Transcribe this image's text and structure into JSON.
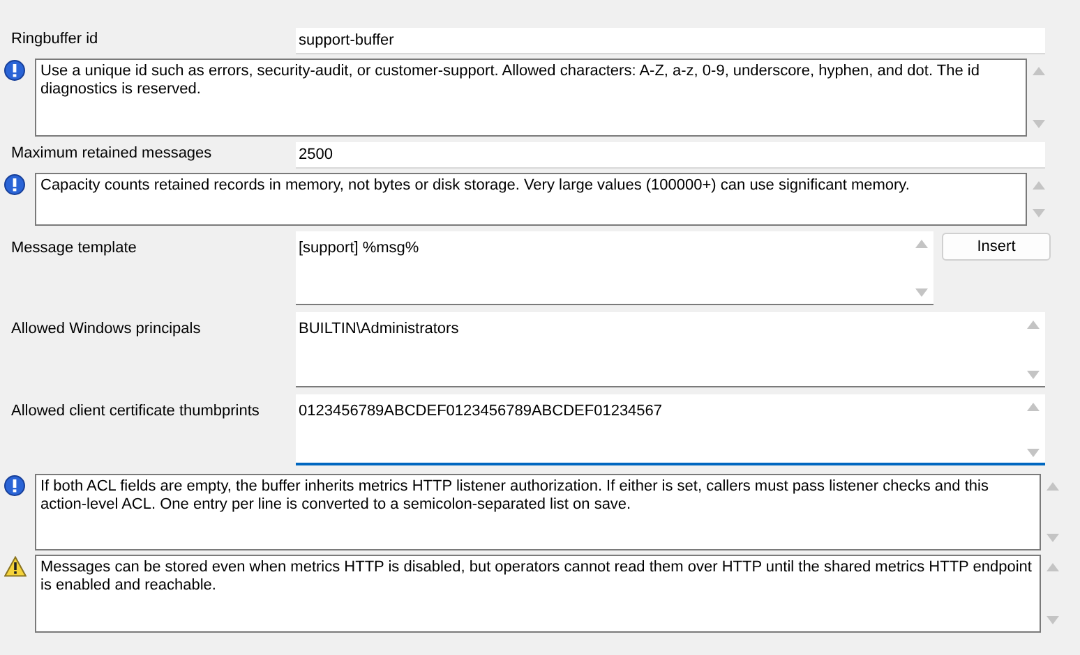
{
  "items": [
    {
      "kind": "text",
      "label": "Ringbuffer id",
      "value": "support-buffer"
    },
    {
      "kind": "info",
      "text": "Use a unique id such as errors, security-audit, or customer-support. Allowed characters: A-Z, a-z, 0-9, underscore, hyphen, and dot. The id diagnostics is reserved."
    },
    {
      "kind": "text",
      "label": "Maximum retained messages",
      "value": "2500"
    },
    {
      "kind": "info",
      "text": "Capacity counts retained records in memory, not bytes or disk storage. Very large values (100000+) can use significant memory."
    },
    {
      "kind": "multiline",
      "label": "Message template",
      "value": "[support] %msg%",
      "button": "Insert",
      "focused": false
    },
    {
      "kind": "multiline",
      "label": "Allowed Windows principals",
      "value": "BUILTIN\\Administrators",
      "focused": false
    },
    {
      "kind": "multiline",
      "label": "Allowed client certificate thumbprints",
      "value": "0123456789ABCDEF0123456789ABCDEF01234567",
      "focused": true
    },
    {
      "kind": "info",
      "text": "If both ACL fields are empty, the buffer inherits metrics HTTP listener authorization. If either is set, callers must pass listener checks and this action-level ACL. One entry per line is converted to a semicolon-separated list on save."
    },
    {
      "kind": "warning",
      "text": "Messages can be stored even when metrics HTTP is disabled, but operators cannot read them over HTTP until the shared metrics HTTP endpoint is enabled and reachable."
    }
  ]
}
